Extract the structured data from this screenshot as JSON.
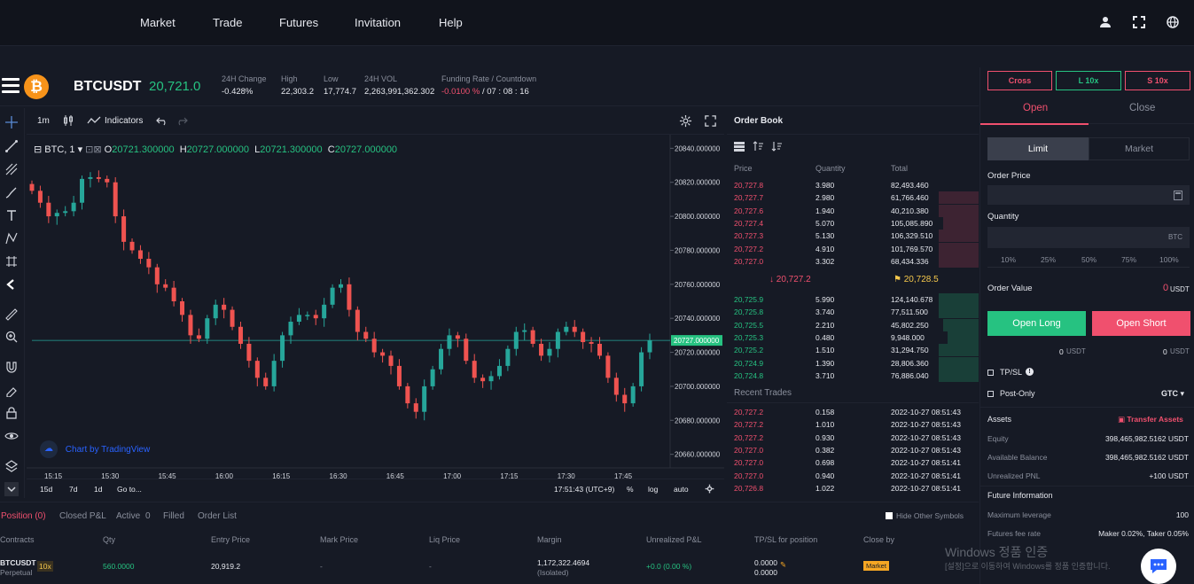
{
  "nav": {
    "items": [
      "Market",
      "Trade",
      "Futures",
      "Invitation",
      "Help"
    ],
    "icons": [
      "user-icon",
      "expand-icon",
      "globe-icon"
    ]
  },
  "ticker": {
    "symbol": "BTCUSDT",
    "price": "20,721.0",
    "stats": [
      {
        "label": "24H Change",
        "value": "-0.428%",
        "color": "red"
      },
      {
        "label": "High",
        "value": "22,303.2"
      },
      {
        "label": "Low",
        "value": "17,774.7"
      },
      {
        "label": "24H VOL",
        "value": "2,263,991,362.302"
      },
      {
        "label": "Funding Rate / Countdown",
        "value_red": "-0.0100 %",
        "value_rest": " / 07 : 08 : 16"
      }
    ]
  },
  "chart_toolbar": {
    "interval": "1m",
    "indicators": "Indicators"
  },
  "chart": {
    "legend_symbol": "BTC, 1",
    "ohlc": {
      "o_label": "O",
      "o": "20721.300000",
      "h_label": "H",
      "h": "20727.000000",
      "l_label": "L",
      "l": "20721.300000",
      "c_label": "C",
      "c": "20727.000000"
    },
    "brand": "Chart by TradingView",
    "time_label": "17:51:43 (UTC+9)",
    "ranges": [
      "15d",
      "7d",
      "1d",
      "Go to..."
    ],
    "scale_opts": [
      "%",
      "log",
      "auto"
    ]
  },
  "chart_data": {
    "type": "candlestick",
    "y_ticks": [
      "20840.000000",
      "20820.000000",
      "20800.000000",
      "20780.000000",
      "20760.000000",
      "20740.000000",
      "20720.000000",
      "20700.000000",
      "20680.000000",
      "20660.000000"
    ],
    "y_values": [
      20840,
      20820,
      20800,
      20780,
      20760,
      20740,
      20720,
      20700,
      20680,
      20660
    ],
    "x_ticks": [
      "15:15",
      "15:30",
      "15:45",
      "16:00",
      "16:15",
      "16:30",
      "16:45",
      "17:00",
      "17:15",
      "17:30",
      "17:45"
    ],
    "last_price_label": "20727.000000",
    "last_price": 20727,
    "close_path": [
      20815,
      20808,
      20800,
      20802,
      20803,
      20808,
      20822,
      20823,
      20822,
      20820,
      20800,
      20785,
      20780,
      20775,
      20770,
      20760,
      20758,
      20750,
      20742,
      20730,
      20728,
      20740,
      20748,
      20745,
      20735,
      20725,
      20715,
      20705,
      20700,
      20715,
      20730,
      20738,
      20742,
      20742,
      20740,
      20748,
      20758,
      20760,
      20745,
      20732,
      20728,
      20720,
      20718,
      20712,
      20700,
      20690,
      20685,
      20700,
      20710,
      20722,
      20730,
      20728,
      20715,
      20705,
      20703,
      20706,
      20712,
      20722,
      20732,
      20733,
      20725,
      20718,
      20722,
      20732,
      20735,
      20732,
      20726,
      20725,
      20718,
      20705,
      20695,
      20690,
      20700,
      20720,
      20727
    ]
  },
  "orderbook": {
    "title": "Order Book",
    "headers": [
      "Price",
      "Quantity",
      "Total"
    ],
    "asks": [
      [
        "20,727.8",
        "3.980",
        "82,493.460"
      ],
      [
        "20,727.7",
        "2.980",
        "61,766.460"
      ],
      [
        "20,727.6",
        "1.940",
        "40,210.380"
      ],
      [
        "20,727.4",
        "5.070",
        "105,085.890"
      ],
      [
        "20,727.3",
        "5.130",
        "106,329.510"
      ],
      [
        "20,727.2",
        "4.910",
        "101,769.570"
      ],
      [
        "20,727.0",
        "3.302",
        "68,434.336"
      ]
    ],
    "mid_sell": "20,727.2",
    "mid_buy": "20,728.5",
    "bids": [
      [
        "20,725.9",
        "5.990",
        "124,140.678"
      ],
      [
        "20,725.8",
        "3.740",
        "77,511.500"
      ],
      [
        "20,725.5",
        "2.210",
        "45,802.250"
      ],
      [
        "20,725.3",
        "0.480",
        "9,948.000"
      ],
      [
        "20,725.2",
        "1.510",
        "31,294.750"
      ],
      [
        "20,724.9",
        "1.390",
        "28,806.360"
      ],
      [
        "20,724.8",
        "3.710",
        "76,886.040"
      ]
    ],
    "recent_title": "Recent Trades",
    "trades": [
      [
        "20,727.2",
        "0.158",
        "2022-10-27 08:51:43"
      ],
      [
        "20,727.2",
        "1.010",
        "2022-10-27 08:51:43"
      ],
      [
        "20,727.2",
        "0.930",
        "2022-10-27 08:51:43"
      ],
      [
        "20,727.0",
        "0.382",
        "2022-10-27 08:51:43"
      ],
      [
        "20,727.0",
        "0.698",
        "2022-10-27 08:51:41"
      ],
      [
        "20,727.0",
        "0.940",
        "2022-10-27 08:51:41"
      ],
      [
        "20,726.8",
        "1.022",
        "2022-10-27 08:51:41"
      ]
    ]
  },
  "right": {
    "cross": "Cross",
    "long_lev": "L 10x",
    "short_lev": "S 10x",
    "tab_open": "Open",
    "tab_close": "Close",
    "limit": "Limit",
    "market": "Market",
    "order_price": "Order Price",
    "quantity": "Quantity",
    "qty_unit": "BTC",
    "pcts": [
      "10%",
      "25%",
      "50%",
      "75%",
      "100%"
    ],
    "order_value": "Order Value",
    "order_value_num": "0",
    "order_value_unit": "USDT",
    "open_long": "Open Long",
    "open_short": "Open Short",
    "long_amt": "0",
    "long_unit": "USDT",
    "short_amt": "0",
    "short_unit": "USDT",
    "tpsl": "TP/SL",
    "post_only": "Post-Only",
    "gtc": "GTC",
    "assets": "Assets",
    "transfer": "Transfer Assets",
    "equity_label": "Equity",
    "equity": "398,465,982.5162 USDT",
    "avail_label": "Available Balance",
    "avail": "398,465,982.5162 USDT",
    "pnl_label": "Unrealized PNL",
    "pnl": "+100 USDT",
    "fut_info": "Future Information",
    "maxlev_label": "Maximum leverage",
    "maxlev": "100",
    "fee_label": "Futures fee rate",
    "fee": "Maker 0.02%, Taker 0.05%"
  },
  "positions": {
    "tabs": [
      "Position (0)",
      "Closed P&L",
      "Active",
      "0",
      "Filled",
      "Order List"
    ],
    "hide_other": "Hide Other Symbols",
    "headers": [
      "Contracts",
      "Qty",
      "Entry Price",
      "Mark Price",
      "Liq Price",
      "Margin",
      "Unrealized P&L",
      "TP/SL for position",
      "Close by"
    ],
    "row": {
      "contract": "BTCUSDT",
      "contract_sub": "Perpetual",
      "lev": "10x",
      "qty": "560.0000",
      "entry": "20,919.2",
      "mark": "-",
      "liq": "-",
      "margin": "1,172,322.4694",
      "margin_sub": "(Isolated)",
      "upl": "+0.0 (0.00 %)",
      "tpsl1": "0.0000",
      "tpsl2": "0.0000",
      "close_by": "Market"
    }
  },
  "watermark": {
    "line1": "Windows 정품 인증",
    "line2": "[설정]으로 이동하여 Windows를 정품 인증합니다."
  }
}
